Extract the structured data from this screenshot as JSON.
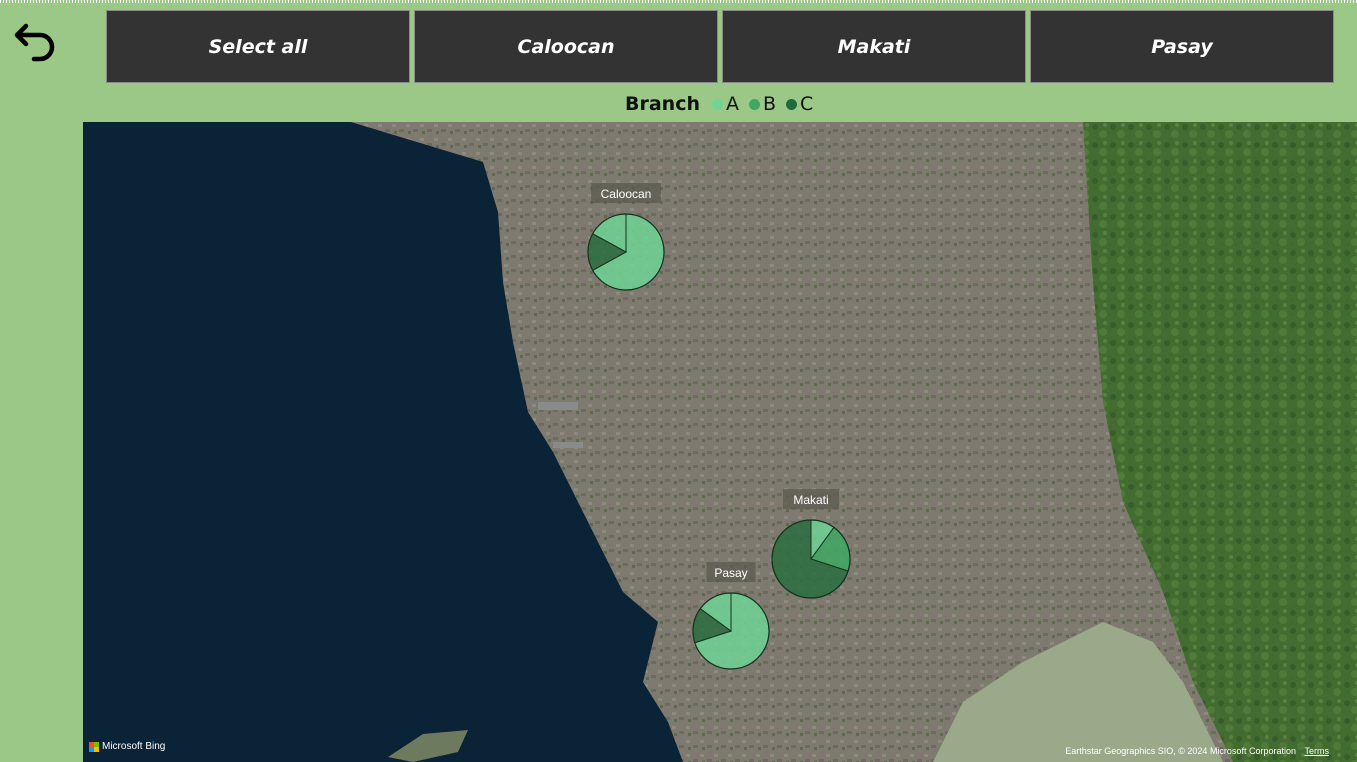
{
  "nav": {
    "back_icon": "undo-arrow-icon"
  },
  "slicers": [
    {
      "label": "Select all"
    },
    {
      "label": "Caloocan"
    },
    {
      "label": "Makati"
    },
    {
      "label": "Pasay"
    }
  ],
  "legend": {
    "title": "Branch",
    "items": [
      {
        "label": "A",
        "color": "#6fd495"
      },
      {
        "label": "B",
        "color": "#3fa865"
      },
      {
        "label": "C",
        "color": "#1f6b3c"
      }
    ]
  },
  "map": {
    "attribution_logo": "Microsoft Bing",
    "copyright": "Earthstar Geographics SIO, © 2024 Microsoft Corporation",
    "terms_link": "Terms",
    "locations": [
      {
        "name": "Caloocan",
        "slices": {
          "A": 0.67,
          "B": 0.0,
          "C": 0.16,
          "A2": 0.17
        }
      },
      {
        "name": "Makati",
        "slices": {
          "A": 0.1,
          "B": 0.2,
          "C": 0.7
        }
      },
      {
        "name": "Pasay",
        "slices": {
          "A": 0.7,
          "B": 0.0,
          "C": 0.15,
          "A2": 0.15
        }
      }
    ]
  },
  "colors": {
    "background": "#9bc887",
    "slicer_bg": "#333333",
    "sea": "#0b2336"
  }
}
